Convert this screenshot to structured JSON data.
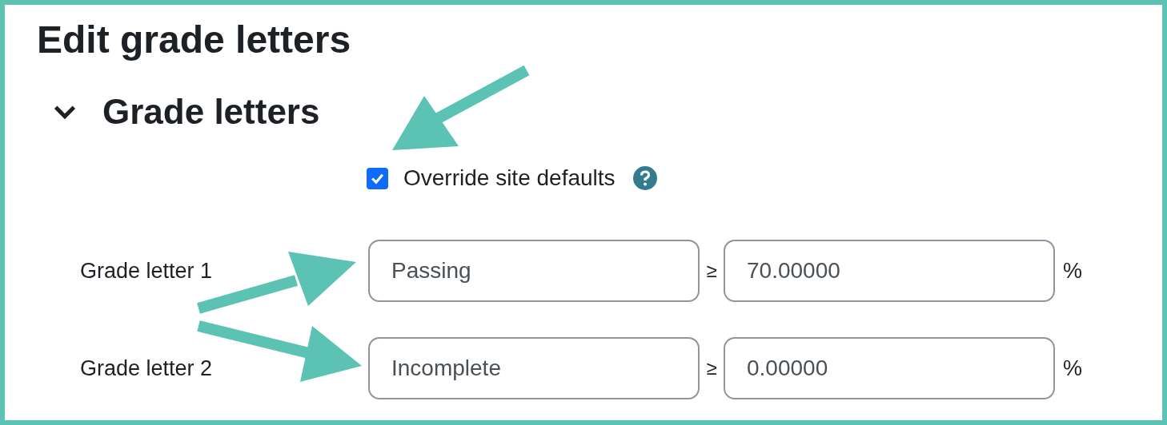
{
  "page": {
    "title": "Edit grade letters"
  },
  "section": {
    "title": "Grade letters",
    "expanded": true
  },
  "override": {
    "label": "Override site defaults",
    "checked": true
  },
  "rows": [
    {
      "label": "Grade letter 1",
      "letter": "Passing",
      "operator": "≥",
      "boundary": "70.00000",
      "unit": "%"
    },
    {
      "label": "Grade letter 2",
      "letter": "Incomplete",
      "operator": "≥",
      "boundary": "0.00000",
      "unit": "%"
    }
  ]
}
